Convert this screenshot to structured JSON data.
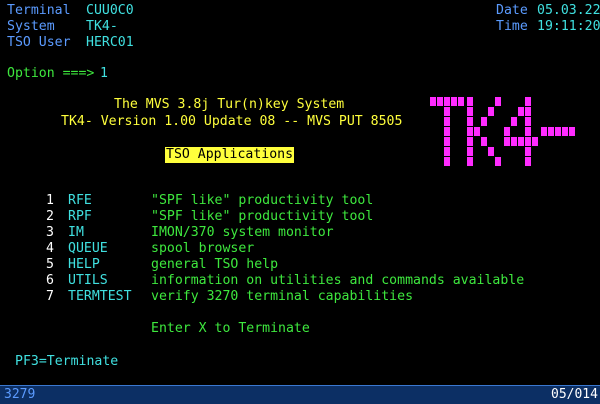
{
  "header": {
    "terminal_label": "Terminal",
    "terminal_value": "CUU0C0",
    "system_label": "System",
    "system_value": "TK4-",
    "tso_user_label": "TSO User",
    "tso_user_value": "HERC01",
    "date_label": "Date",
    "date_value": "05.03.22",
    "time_label": "Time",
    "time_value": "19:11:20"
  },
  "option": {
    "label": "Option ===>",
    "value": "1"
  },
  "title": {
    "line1": "The MVS 3.8j Tur(n)key System",
    "line2": "TK4- Version 1.00 Update 08 -- MVS PUT 8505"
  },
  "logo_text": "TK4-",
  "section_title": "TSO Applications",
  "menu": [
    {
      "num": "1",
      "name": "RFE",
      "desc": "\"SPF like\" productivity tool"
    },
    {
      "num": "2",
      "name": "RPF",
      "desc": "\"SPF like\" productivity tool"
    },
    {
      "num": "3",
      "name": "IM",
      "desc": "IMON/370 system monitor"
    },
    {
      "num": "4",
      "name": "QUEUE",
      "desc": "spool browser"
    },
    {
      "num": "5",
      "name": "HELP",
      "desc": "general TSO help"
    },
    {
      "num": "6",
      "name": "UTILS",
      "desc": "information on utilities and commands available"
    },
    {
      "num": "7",
      "name": "TERMTEST",
      "desc": "verify 3270 terminal capabilities"
    }
  ],
  "terminate_text": "Enter X to Terminate",
  "pf3_text": "PF3=Terminate",
  "status": {
    "model": "3279",
    "cursor": "05/014"
  },
  "colors": {
    "background": "#000000",
    "label": "#5b9bff",
    "value": "#40e0e0",
    "menu_text": "#3ee83e",
    "title": "#ffff3c",
    "logo": "#ff2bff",
    "status_bar": "#0c2f64"
  }
}
